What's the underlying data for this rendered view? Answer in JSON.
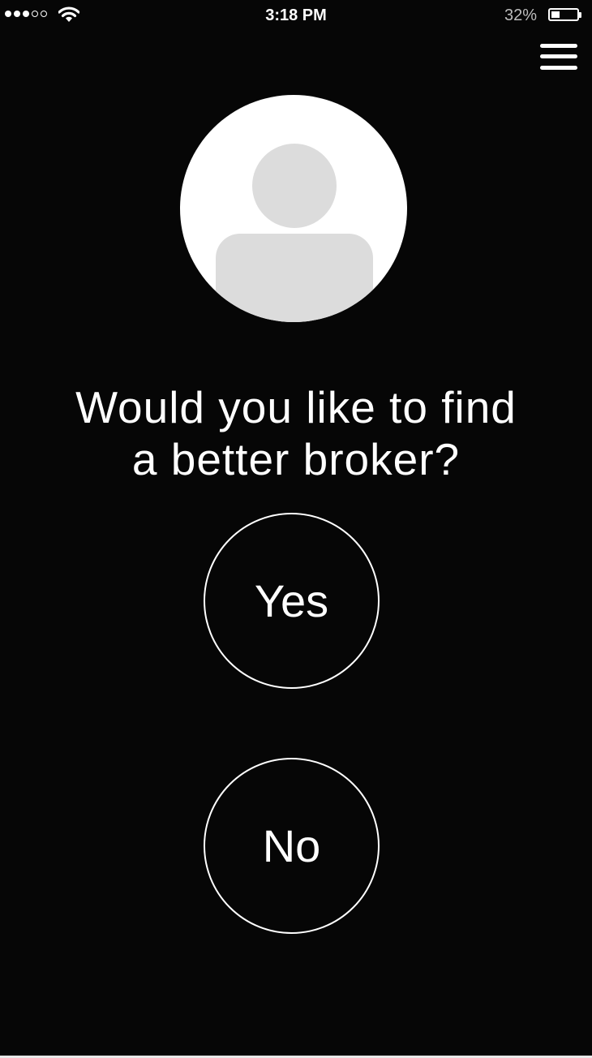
{
  "status_bar": {
    "time": "3:18 PM",
    "battery_percent": "32%",
    "battery_level": 0.32,
    "signal_bars_filled": 3,
    "signal_bars_total": 5,
    "icons": [
      "signal-dots-icon",
      "wifi-icon",
      "battery-icon"
    ]
  },
  "header": {
    "menu_icon": "hamburger-menu-icon"
  },
  "profile": {
    "avatar_icon": "user-placeholder-icon"
  },
  "question": {
    "line1": "Would you like to find",
    "line2": "a better broker?"
  },
  "choices": {
    "yes_label": "Yes",
    "no_label": "No"
  },
  "colors": {
    "background": "#060606",
    "foreground": "#ffffff",
    "avatar_bg": "#ffffff",
    "avatar_silhouette": "#dcdcdc",
    "battery_text": "#bdbdbd"
  }
}
